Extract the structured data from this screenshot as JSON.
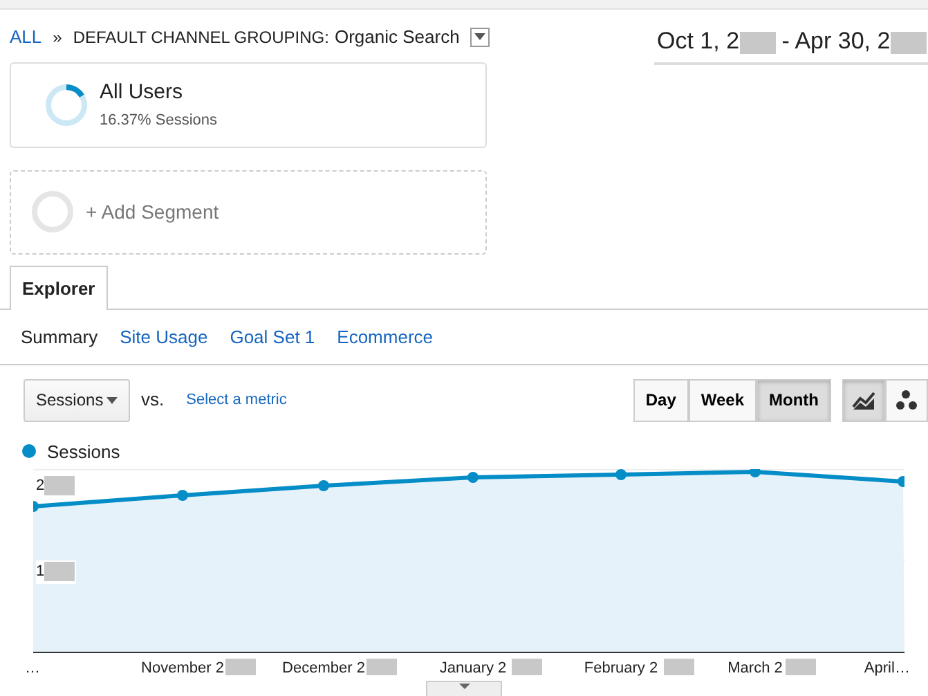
{
  "breadcrumb": {
    "root": "ALL",
    "separator": "»",
    "dimension": "DEFAULT CHANNEL GROUPING:",
    "value": "Organic Search"
  },
  "date_range": {
    "start": "Oct 1, 2",
    "end": "- Apr 30, 2"
  },
  "segments": [
    {
      "name": "All Users",
      "share": "16.37% Sessions",
      "level": 0.1637
    }
  ],
  "add_segment": "+ Add Segment",
  "tabs": [
    {
      "label": "Explorer",
      "selected": true
    }
  ],
  "subtabs": [
    {
      "label": "Summary",
      "selected": true
    },
    {
      "label": "Site Usage",
      "selected": false
    },
    {
      "label": "Goal Set 1",
      "selected": false
    },
    {
      "label": "Ecommerce",
      "selected": false
    }
  ],
  "metric": {
    "value": "Sessions",
    "vs": "vs.",
    "compare": "Select a metric"
  },
  "periods": [
    {
      "label": "Day",
      "selected": false
    },
    {
      "label": "Week",
      "selected": false
    },
    {
      "label": "Month",
      "selected": true
    }
  ],
  "chart_types": [
    {
      "kind": "line",
      "selected": true
    },
    {
      "kind": "motion",
      "selected": false
    }
  ],
  "legend": {
    "label": "Sessions",
    "color": "#058dc7"
  },
  "chart": {
    "y_labels": [
      "2",
      "1"
    ],
    "x_labels": [
      "…",
      "November 2",
      "December 2",
      "January 2",
      "February 2",
      "March 2",
      "April…"
    ]
  }
}
